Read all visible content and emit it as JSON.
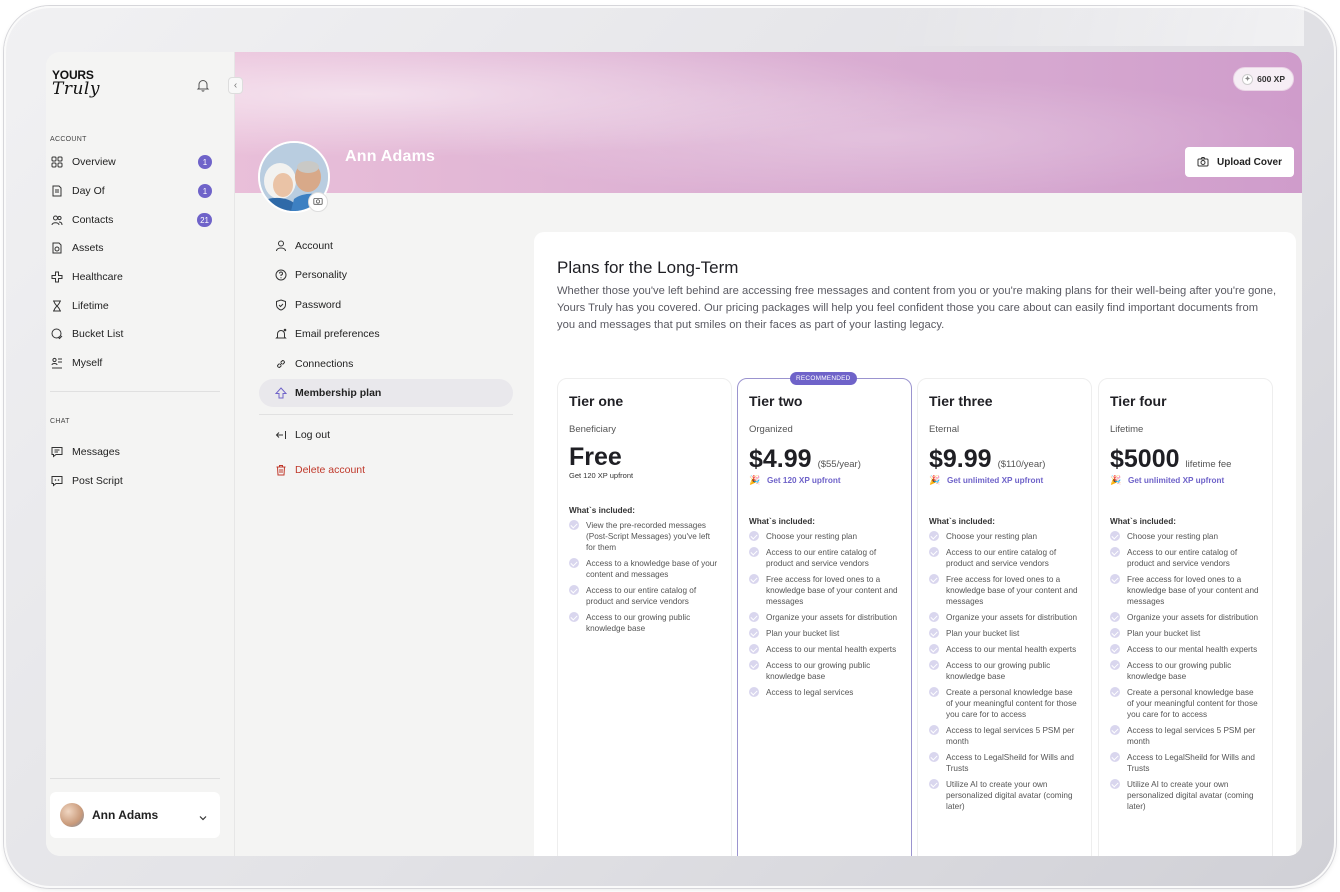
{
  "sidebar": {
    "logo_top": "YOURS",
    "logo_bottom": "Truly",
    "account_label": "ACCOUNT",
    "chat_label": "CHAT",
    "items": [
      {
        "label": "Overview",
        "badge": "1"
      },
      {
        "label": "Day Of",
        "badge": "1"
      },
      {
        "label": "Contacts",
        "badge": "21"
      },
      {
        "label": "Assets",
        "badge": ""
      },
      {
        "label": "Healthcare",
        "badge": ""
      },
      {
        "label": "Lifetime",
        "badge": ""
      },
      {
        "label": "Bucket List",
        "badge": ""
      },
      {
        "label": "Myself",
        "badge": ""
      }
    ],
    "chat_items": [
      {
        "label": "Messages"
      },
      {
        "label": "Post Script"
      }
    ],
    "user_name": "Ann Adams"
  },
  "header": {
    "xp": "600 XP",
    "upload_label": "Upload Cover",
    "profile_name": "Ann Adams"
  },
  "settings_nav": {
    "items": [
      {
        "label": "Account"
      },
      {
        "label": "Personality"
      },
      {
        "label": "Password"
      },
      {
        "label": "Email preferences"
      },
      {
        "label": "Connections"
      },
      {
        "label": "Membership plan"
      }
    ],
    "logout": "Log out",
    "delete": "Delete account"
  },
  "plans": {
    "title": "Plans for the Long-Term",
    "description": "Whether those you've left behind are accessing free messages and content from you or you're making plans for their well-being after you're gone, Yours Truly has you covered. Our pricing packages will help you feel confident those you care about can easily find important documents from you and messages that put smiles on their faces as part of your lasting legacy.",
    "included_label": "What`s included:",
    "recommended_tag": "RECOMMENDED",
    "tiers": [
      {
        "name": "Tier one",
        "subtitle": "Beneficiary",
        "price": "Free",
        "price_note": "",
        "xp_text": "Get 120 XP upfront",
        "features": [
          "View the pre-recorded messages (Post-Script Messages) you've left for them",
          "Access to a knowledge base of your content and messages",
          "Access to our entire catalog of product and service vendors",
          "Access to our growing public knowledge base"
        ]
      },
      {
        "name": "Tier two",
        "subtitle": "Organized",
        "price": "$4.99",
        "price_note": "($55/year)",
        "xp_text": "Get 120 XP upfront",
        "features": [
          "Choose your resting plan",
          "Access to our entire catalog of product and service vendors",
          "Free access for loved ones to a knowledge base of your content and messages",
          "Organize your assets for distribution",
          "Plan your bucket list",
          "Access to our mental health experts",
          "Access to our growing public knowledge base",
          "Access to legal services"
        ]
      },
      {
        "name": "Tier three",
        "subtitle": "Eternal",
        "price": "$9.99",
        "price_note": "($110/year)",
        "xp_text": "Get unlimited XP upfront",
        "features": [
          "Choose your resting plan",
          "Access to our entire catalog of product and service vendors",
          "Free access for loved ones to a knowledge base of your content and messages",
          "Organize your assets for distribution",
          "Plan your bucket list",
          "Access to our mental health experts",
          "Access to our growing public knowledge base",
          "Create a personal knowledge base of your meaningful content for those you care for to access",
          "Access to legal services 5 PSM per month",
          "Access to LegalSheild for Wills and Trusts",
          "Utilize AI to create your own personalized digital avatar (coming later)"
        ]
      },
      {
        "name": "Tier four",
        "subtitle": "Lifetime",
        "price": "$5000",
        "price_note": "lifetime fee",
        "xp_text": "Get unlimited XP upfront",
        "features": [
          "Choose your resting plan",
          "Access to our entire catalog of product and service vendors",
          "Free access for loved ones to a knowledge base of your content and messages",
          "Organize your assets for distribution",
          "Plan your bucket list",
          "Access to our mental health experts",
          "Access to our growing public knowledge base",
          "Create a personal knowledge base of your meaningful content for those you care for to access",
          "Access to legal services 5 PSM per month",
          "Access to LegalSheild for Wills and Trusts",
          "Utilize AI to create your own personalized digital avatar (coming later)"
        ]
      }
    ]
  },
  "colors": {
    "accent": "#6f63c9",
    "danger": "#c0392b",
    "cover_pink": "#dcb0d3"
  }
}
